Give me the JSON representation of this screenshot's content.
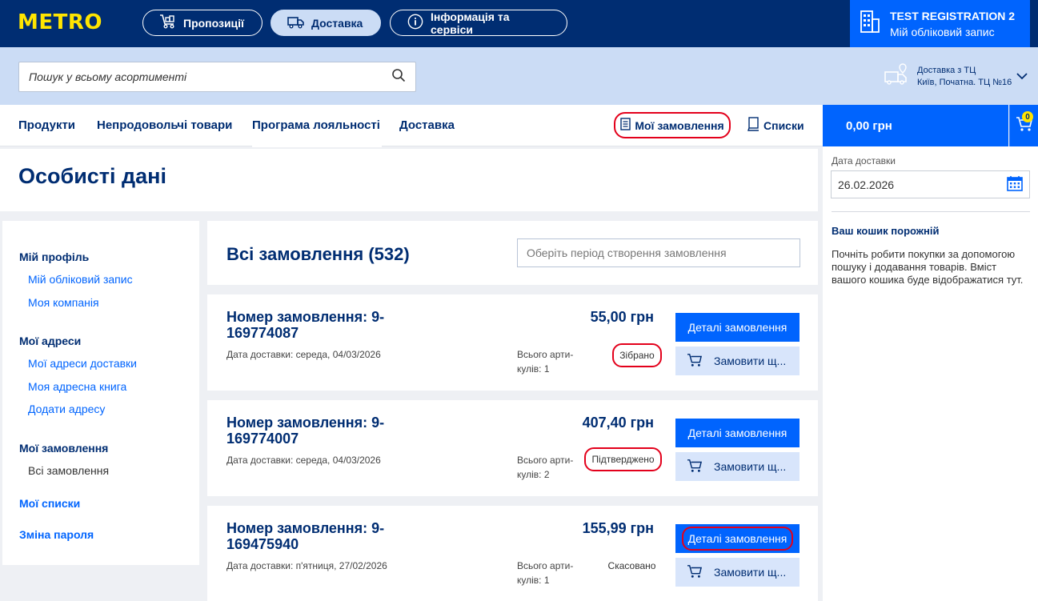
{
  "brand": {
    "logo": "METRO"
  },
  "top_nav": [
    {
      "label": "Пропозиції",
      "icon": "cart-dolly-icon"
    },
    {
      "label": "Доставка",
      "icon": "truck-icon",
      "active": true
    },
    {
      "label": "Інформація та сервіси",
      "icon": "info-icon"
    }
  ],
  "account": {
    "name": "TEST REGISTRATION 2",
    "link": "Мій обліковий запис",
    "icon": "building-icon"
  },
  "search": {
    "placeholder": "Пошук у всьому асортименті",
    "icon": "search-icon"
  },
  "delivery_selector": {
    "line1": "Доставка з ТЦ",
    "line2": "Київ, Початна. ТЦ №16"
  },
  "main_nav": [
    "Продукти",
    "Непродовольчі товари",
    "Програма лояльності",
    "Доставка"
  ],
  "my_orders": "Мої замовлення",
  "lists": "Списки",
  "cart": {
    "total": "0,00 грн",
    "count": "0"
  },
  "page_title": "Особисті дані",
  "sidebar": {
    "profile_heading": "Мій профіль",
    "profile_items": [
      "Мій обліковий запис",
      "Моя компанія"
    ],
    "addresses_heading": "Мої адреси",
    "address_items": [
      "Мої адреси доставки",
      "Моя адресна книга",
      "Додати адресу"
    ],
    "orders_heading": "Мої замовлення",
    "orders_items": [
      "Всі замовлення"
    ],
    "lists_heading": "Мої списки",
    "password_heading": "Зміна пароля"
  },
  "orders_header": {
    "title": "Всі замовлення (532)",
    "period_placeholder": "Оберіть період створення замовлення"
  },
  "orders": [
    {
      "number_line1": "Номер замовлення:  9-",
      "number_line2": "169774087",
      "date_label": "Дата доставки:  середа, 04/03/2026",
      "count_line1": "Всього арти-",
      "count_line2": "кулів: 1",
      "price": "55,00 грн",
      "status": "Зібрано",
      "details": "Деталі замовлення",
      "reorder": "Замовити щ..."
    },
    {
      "number_line1": "Номер замовлення:  9-",
      "number_line2": "169774007",
      "date_label": "Дата доставки:  середа, 04/03/2026",
      "count_line1": "Всього арти-",
      "count_line2": "кулів: 2",
      "price": "407,40 грн",
      "status": "Підтверджено",
      "details": "Деталі замовлення",
      "reorder": "Замовити щ..."
    },
    {
      "number_line1": "Номер замовлення:  9-",
      "number_line2": "169475940",
      "date_label": "Дата доставки:  п'ятниця, 27/02/2026",
      "count_line1": "Всього арти-",
      "count_line2": "кулів: 1",
      "price": "155,99 грн",
      "status": "Скасовано",
      "details": "Деталі замовлення",
      "reorder": "Замовити щ..."
    }
  ],
  "right_panel": {
    "date_label": "Дата доставки",
    "date_value": "26.02.2026",
    "empty_title": "Ваш кошик порожній",
    "empty_desc": "Почніть робити покупки за допомогою пошуку і додавання товарів. Вміст вашого кошика буде відображатися тут."
  },
  "colors": {
    "navy": "#002d72",
    "blue": "#0064fe",
    "yellow": "#ffe500",
    "light_blue": "#cbdcf5",
    "highlight": "#e3001b"
  }
}
